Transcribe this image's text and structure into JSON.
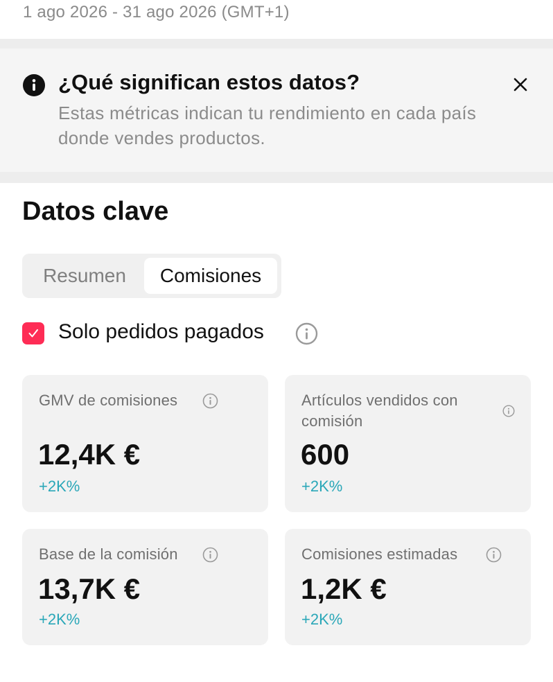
{
  "header": {
    "date_range": "1 ago 2026 - 31 ago 2026 (GMT+1)"
  },
  "info_banner": {
    "title": "¿Qué significan estos datos?",
    "body": "Estas métricas indican tu rendimiento en cada país donde vendes productos.",
    "icon": "info-icon",
    "close_icon": "close-icon"
  },
  "section": {
    "title": "Datos clave"
  },
  "tabs": [
    {
      "label": "Resumen",
      "selected": false
    },
    {
      "label": "Comisiones",
      "selected": true
    }
  ],
  "filter": {
    "label": "Solo pedidos pagados",
    "checked": true,
    "accent_color": "#fe2c55"
  },
  "metrics": [
    {
      "label": "GMV de comisiones",
      "value": "12,4K €",
      "change": "+2K%"
    },
    {
      "label": "Artículos vendidos con comisión",
      "value": "600",
      "change": "+2K%"
    },
    {
      "label": "Base de la comisión",
      "value": "13,7K €",
      "change": "+2K%"
    },
    {
      "label": "Comisiones estimadas",
      "value": "1,2K €",
      "change": "+2K%"
    }
  ],
  "colors": {
    "change_text": "#2aa7b8",
    "card_background": "#f2f2f2"
  }
}
